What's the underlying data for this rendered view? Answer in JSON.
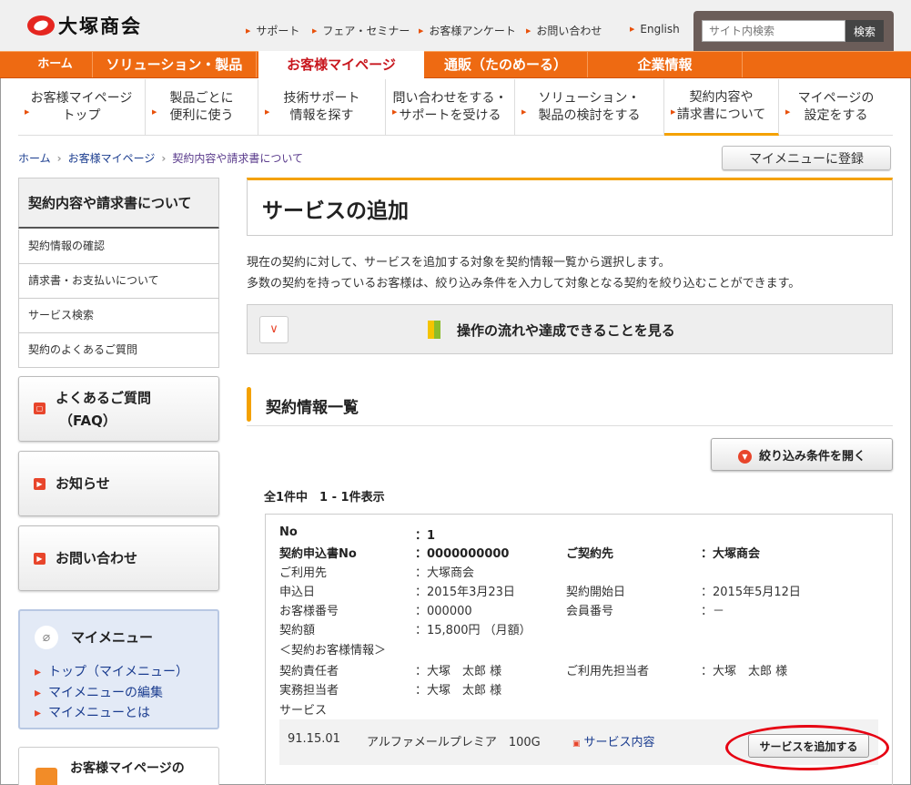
{
  "header": {
    "logo_text": "大塚商会",
    "utility_links": [
      "サポート",
      "フェア・セミナー",
      "お客様アンケート",
      "お問い合わせ",
      "English"
    ],
    "search": {
      "placeholder": "サイト内検索",
      "button": "検索"
    }
  },
  "main_nav": [
    "ホーム",
    "ソリューション・製品",
    "お客様マイページ",
    "通販（たのめーる）",
    "企業情報"
  ],
  "sub_nav": [
    {
      "l1": "お客様マイページ",
      "l2": "トップ"
    },
    {
      "l1": "製品ごとに",
      "l2": "便利に使う"
    },
    {
      "l1": "技術サポート",
      "l2": "情報を探す"
    },
    {
      "l1": "問い合わせをする・",
      "l2": "サポートを受ける"
    },
    {
      "l1": "ソリューション・",
      "l2": "製品の検討をする"
    },
    {
      "l1": "契約内容や",
      "l2": "請求書について"
    },
    {
      "l1": "マイページの",
      "l2": "設定をする"
    }
  ],
  "breadcrumb": [
    "ホーム",
    "お客様マイページ",
    "契約内容や請求書について"
  ],
  "mymenu_register": "マイメニューに登録",
  "sidebar": {
    "title": "契約内容や請求書について",
    "items": [
      "契約情報の確認",
      "請求書・お支払いについて",
      "サービス検索",
      "契約のよくあるご質問"
    ],
    "faq_l1": "よくあるご質問",
    "faq_l2": "（FAQ）",
    "news": "お知らせ",
    "contact": "お問い合わせ",
    "mymenu": {
      "title": "マイメニュー",
      "links": [
        "トップ（マイメニュー）",
        "マイメニューの編集",
        "マイメニューとは"
      ]
    },
    "promo": "お客様マイページの"
  },
  "page": {
    "title": "サービスの追加",
    "desc1": "現在の契約に対して、サービスを追加する対象を契約情報一覧から選択します。",
    "desc2": "多数の契約を持っているお客様は、絞り込み条件を入力して対象となる契約を絞り込むことができます。",
    "flow_text": "操作の流れや達成できることを見る",
    "section_title": "契約情報一覧",
    "filter_button": "絞り込み条件を開く",
    "count_text": "全1件中　1 - 1件表示"
  },
  "contract": {
    "no_label": "No",
    "no_value": "：1",
    "app_label": "契約申込書No",
    "app_value": "：0000000000",
    "party_label": "ご契約先",
    "party_value": "：大塚商会",
    "user_label": "ご利用先",
    "user_value": "：大塚商会",
    "apply_label": "申込日",
    "apply_value": "：2015年3月23日",
    "start_label": "契約開始日",
    "start_value": "：2015年5月12日",
    "cust_label": "お客様番号",
    "cust_value": "：000000",
    "member_label": "会員番号",
    "member_value": "：－",
    "amount_label": "契約額",
    "amount_value": "：15,800円 （月額）",
    "info_heading": "＜契約お客様情報＞",
    "resp_label": "契約責任者",
    "resp_value": "：大塚　太郎 様",
    "site_label": "ご利用先担当者",
    "site_value": "：大塚　太郎 様",
    "work_label": "実務担当者",
    "work_value": "：大塚　太郎 様",
    "service_label": "サービス",
    "service": {
      "code": "91.15.01",
      "name": "アルファメールプレミア　100G",
      "link": "サービス内容",
      "add_button": "サービスを追加する"
    }
  },
  "colors": {
    "accent": "#ee6a12",
    "highlight": "#e60012",
    "brand": "#c8171e"
  }
}
